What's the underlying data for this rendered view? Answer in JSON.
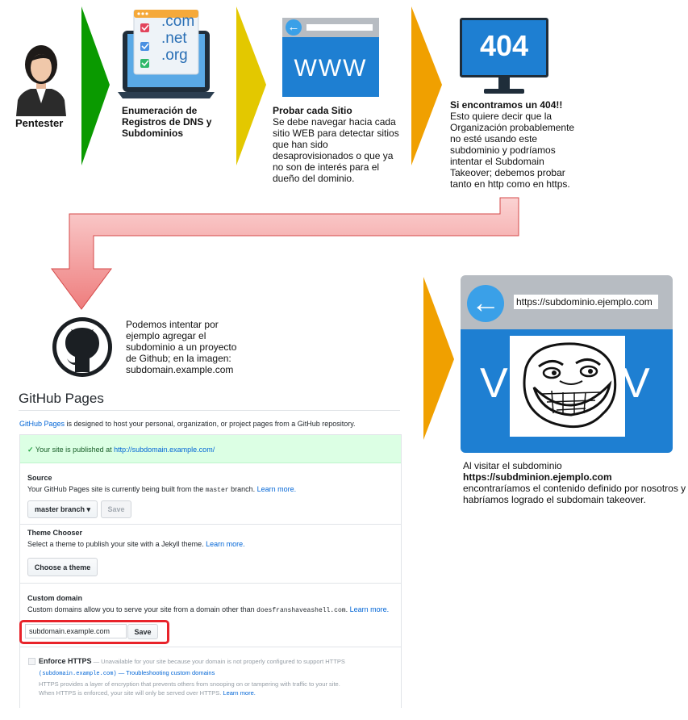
{
  "pentester": {
    "label": "Pentester"
  },
  "step1": {
    "title": "Enumeración de Registros de DNS y Subdominios",
    "title_lines": [
      "Enumeración de",
      "Registros de DNS y",
      "Subdominios"
    ],
    "domains": [
      ".com",
      ".net",
      ".org"
    ]
  },
  "step2": {
    "icon_text": "WWW",
    "title": "Probar cada Sitio",
    "body_lines": [
      "Se debe navegar hacia cada",
      "sitio WEB para detectar sitios",
      "que han sido",
      "desaprovisionados o que ya",
      "no son de interés para el",
      "dueño del dominio."
    ]
  },
  "step3": {
    "icon_text": "404",
    "title": "Si encontramos un 404!!",
    "body_lines": [
      "Esto quiere decir que la",
      "Organización probablemente",
      "no esté usando este",
      "subdominio y podríamos",
      "intentar el Subdomain",
      "Takeover; debemos probar",
      "tanto en http como en https."
    ]
  },
  "step4": {
    "body_lines": [
      "Podemos intentar por",
      "ejemplo agregar el",
      "subdominio a un proyecto",
      "de Github; en la imagen:",
      "subdomain.example.com"
    ]
  },
  "step5": {
    "url": "https://subdominio.ejemplo.com",
    "icon_text_left": "V",
    "icon_text_right": "V",
    "line1": "Al visitar el subdominio",
    "line2": "https://subdminion.ejemplo.com",
    "line3": "encontraríamos el contenido definido por nosotros y",
    "line4": "habríamos logrado el subdomain takeover."
  },
  "github_pages": {
    "title": "GitHub Pages",
    "intro_link": "GitHub Pages",
    "intro_rest": " is designed to host your personal, organization, or project pages from a GitHub repository.",
    "published_prefix": "Your site is published at ",
    "published_url": "http://subdomain.example.com/",
    "source": {
      "title": "Source",
      "desc_pre": "Your GitHub Pages site is currently being built from the ",
      "desc_branch": "master",
      "desc_post": " branch. ",
      "learn_more": "Learn more.",
      "branch_button": "master branch ▾",
      "save_button": "Save"
    },
    "theme": {
      "title": "Theme Chooser",
      "desc": "Select a theme to publish your site with a Jekyll theme. ",
      "learn_more": "Learn more.",
      "button": "Choose a theme"
    },
    "custom_domain": {
      "title": "Custom domain",
      "desc_pre": "Custom domains allow you to serve your site from a domain other than ",
      "desc_domain": "doesfranshaveashell.com",
      "desc_post": ". ",
      "learn_more": "Learn more.",
      "input_value": "subdomain.example.com",
      "save_button": "Save"
    },
    "https": {
      "title": "Enforce HTTPS",
      "desc1": " — Unavailable for your site because your domain is not properly configured to support HTTPS",
      "desc2_domain": "(subdomain.example.com)",
      "desc2_rest": " — Troubleshooting custom domains",
      "desc3": "HTTPS provides a layer of encryption that prevents others from snooping on or tampering with traffic to your site.",
      "desc4": "When HTTPS is enforced, your site will only be served over HTTPS. ",
      "learn_more": "Learn more."
    }
  },
  "colors": {
    "green_arrow": "#0a9a00",
    "yellow_arrow": "#e3c800",
    "orange_arrow": "#f0a000",
    "pink_arrow": "#f6a3a3",
    "blue": "#1e7fd2",
    "highlight": "#e8232a"
  }
}
